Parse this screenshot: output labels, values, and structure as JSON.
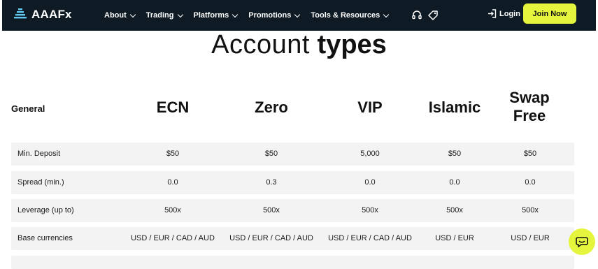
{
  "brand": {
    "name_prefix": "AAA",
    "name_suffix": "Fx"
  },
  "nav": {
    "items": [
      {
        "label": "About"
      },
      {
        "label": "Trading"
      },
      {
        "label": "Platforms"
      },
      {
        "label": "Promotions"
      },
      {
        "label": "Tools & Resources"
      }
    ],
    "login_label": "Login",
    "join_label": "Join Now"
  },
  "heading": {
    "light": "Account",
    "bold": "types"
  },
  "table": {
    "general_label": "General",
    "columns": [
      "ECN",
      "Zero",
      "VIP",
      "Islamic",
      "Swap Free"
    ],
    "rows": [
      {
        "label": "Min. Deposit",
        "values": [
          "$50",
          "$50",
          "5,000",
          "$50",
          "$50"
        ]
      },
      {
        "label": "Spread (min.)",
        "values": [
          "0.0",
          "0.3",
          "0.0",
          "0.0",
          "0.0"
        ]
      },
      {
        "label": "Leverage (up to)",
        "values": [
          "500x",
          "500x",
          "500x",
          "500x",
          "500x"
        ]
      },
      {
        "label": "Base currencies",
        "values": [
          "USD / EUR / CAD / AUD",
          "USD / EUR / CAD / AUD",
          "USD / EUR / CAD / AUD",
          "USD / EUR",
          "USD / EUR"
        ]
      }
    ]
  },
  "colors": {
    "nav_bg": "#0e1b24",
    "accent": "#e5f53d",
    "row_bg": "#f3f3f3"
  }
}
